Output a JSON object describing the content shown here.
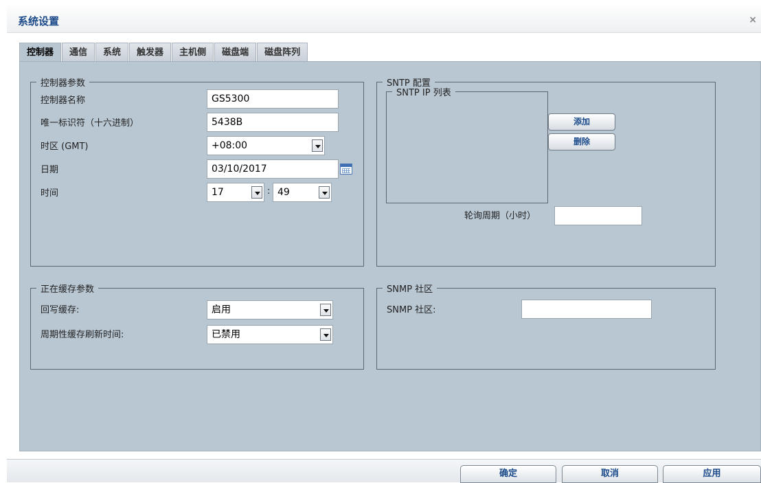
{
  "window": {
    "title": "系统设置",
    "close_label": "×"
  },
  "tabs": [
    {
      "label": "控制器"
    },
    {
      "label": "通信"
    },
    {
      "label": "系统"
    },
    {
      "label": "触发器"
    },
    {
      "label": "主机侧"
    },
    {
      "label": "磁盘端"
    },
    {
      "label": "磁盘阵列"
    }
  ],
  "controller_params": {
    "legend": "控制器参数",
    "name_label": "控制器名称",
    "name_value": "GS5300",
    "uid_label": "唯一标识符（十六进制）",
    "uid_value": "5438B",
    "timezone_label": "时区 (GMT)",
    "timezone_value": "+08:00",
    "date_label": "日期",
    "date_value": "03/10/2017",
    "time_label": "时间",
    "hour_value": "17",
    "time_sep": ":",
    "minute_value": "49"
  },
  "sntp": {
    "legend": "SNTP 配置",
    "ip_list_legend": "SNTP IP 列表",
    "add_label": "添加",
    "delete_label": "删除",
    "poll_label": "轮询周期（小时）",
    "poll_value": ""
  },
  "cache_params": {
    "legend": "正在缓存参数",
    "writeback_label": "回写缓存:",
    "writeback_value": "启用",
    "flush_label": "周期性缓存刷新时间:",
    "flush_value": "已禁用"
  },
  "snmp": {
    "legend": "SNMP 社区",
    "community_label": "SNMP 社区:",
    "community_value": ""
  },
  "footer": {
    "ok_label": "确定",
    "cancel_label": "取消",
    "apply_label": "应用"
  }
}
